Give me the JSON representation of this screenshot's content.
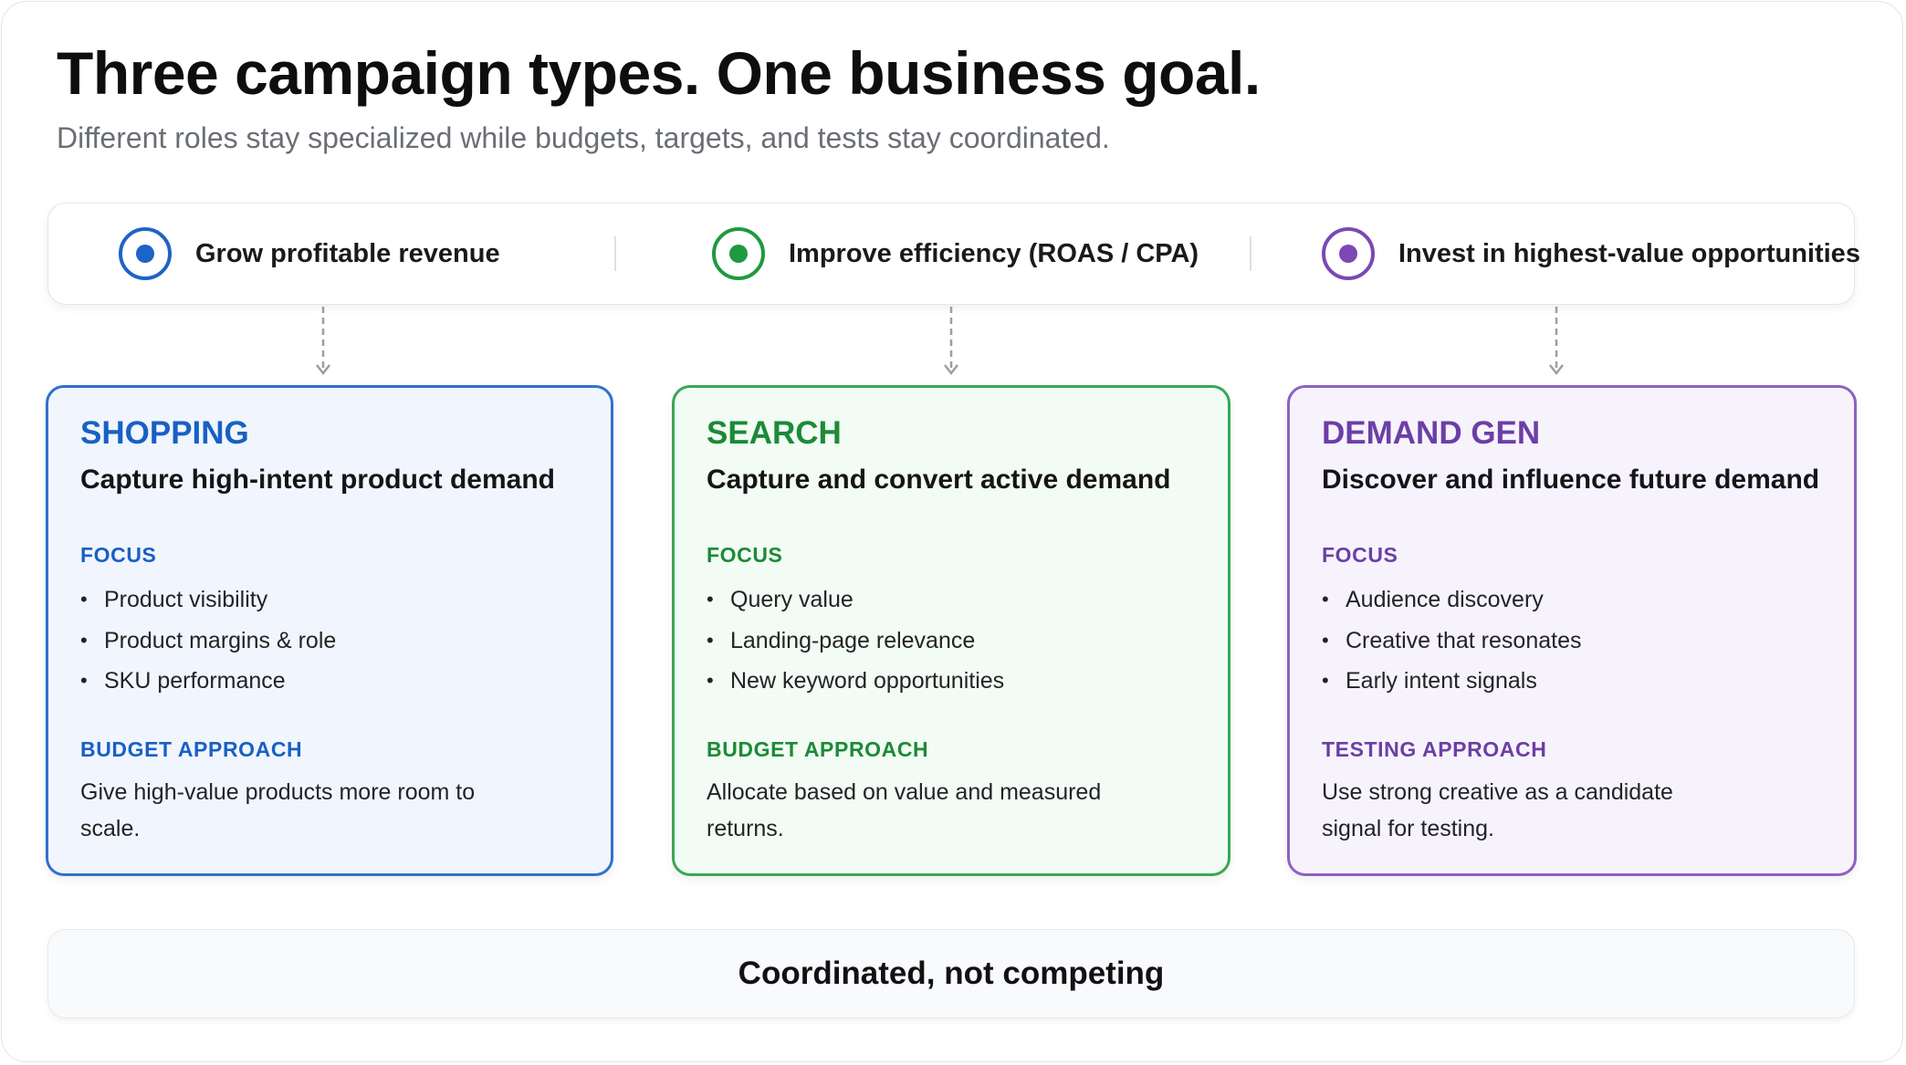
{
  "title": "Three campaign types. One business goal.",
  "subtitle": "Different roles stay specialized while budgets, targets, and tests stay coordinated.",
  "goals": [
    {
      "label": "Grow profitable revenue",
      "color": "#1e63c8"
    },
    {
      "label": "Improve efficiency (ROAS / CPA)",
      "color": "#1f9a3f"
    },
    {
      "label": "Invest in highest-value opportunities",
      "color": "#7a49b4"
    }
  ],
  "cards": [
    {
      "name": "SHOPPING",
      "tagline": "Capture high-intent product demand",
      "focus_heading": "FOCUS",
      "focus_items": [
        "Product visibility",
        "Product margins & role",
        "SKU performance"
      ],
      "approach_heading": "BUDGET APPROACH",
      "approach_text": "Give high-value products more room to scale.",
      "accent": "#1960c4",
      "border": "#2f70cf",
      "background": "#f1f6fe"
    },
    {
      "name": "SEARCH",
      "tagline": "Capture and convert active demand",
      "focus_heading": "FOCUS",
      "focus_items": [
        "Query value",
        "Landing-page relevance",
        "New keyword opportunities"
      ],
      "approach_heading": "BUDGET APPROACH",
      "approach_text": "Allocate based on value and measured returns.",
      "accent": "#1c8a37",
      "border": "#38a855",
      "background": "#f2fbf4"
    },
    {
      "name": "DEMAND GEN",
      "tagline": "Discover and influence future demand",
      "focus_heading": "FOCUS",
      "focus_items": [
        "Audience discovery",
        "Creative that resonates",
        "Early intent signals"
      ],
      "approach_heading": "TESTING APPROACH",
      "approach_text": "Use strong creative as a candidate signal for testing.",
      "accent": "#6b3fa6",
      "border": "#8c62c2",
      "background": "#f7f3fc"
    }
  ],
  "footer": "Coordinated, not competing",
  "bullet_glyph": "•"
}
